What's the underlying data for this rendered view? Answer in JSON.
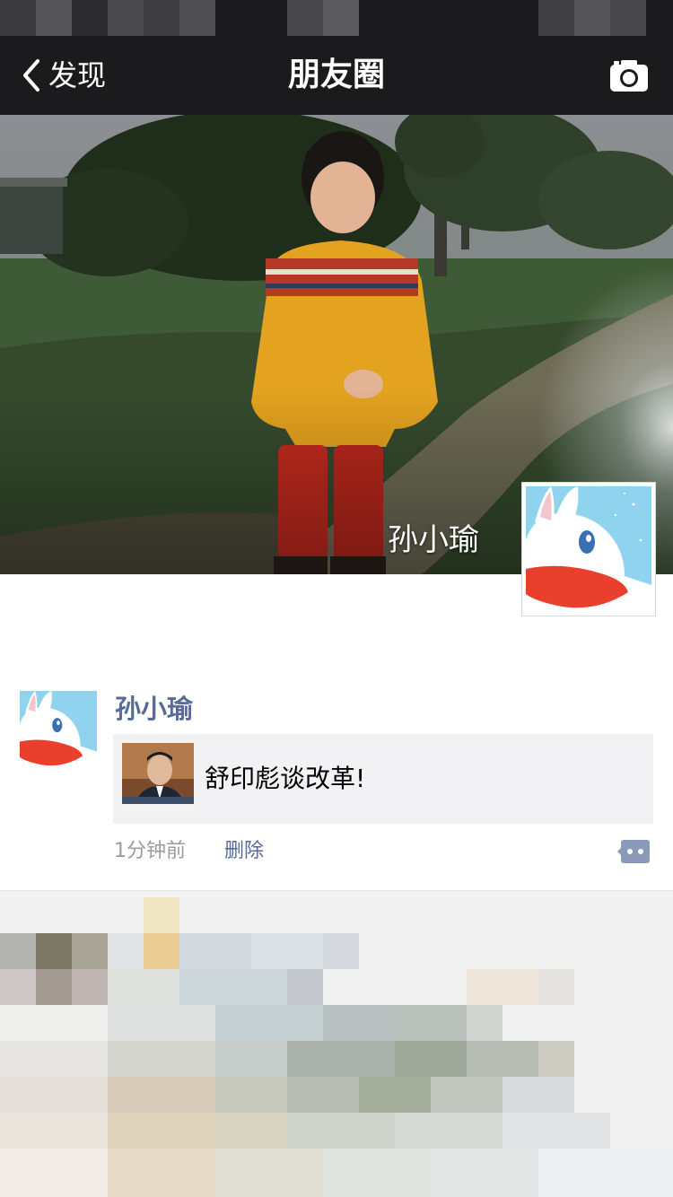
{
  "nav": {
    "back_label": "发现",
    "title": "朋友圈",
    "back_icon": "chevron-left-icon",
    "camera_icon": "camera-icon"
  },
  "profile": {
    "cover_name": "孙小瑜",
    "avatar_icon": "rabbit-avatar"
  },
  "post": {
    "author": "孙小瑜",
    "share_text": "舒印彪谈改革!",
    "time": "1分钟前",
    "delete_label": "删除",
    "comment_icon": "comment-icon"
  },
  "colors": {
    "nav_bg": "#1b1b1d",
    "link": "#576b95",
    "card_bg": "#f2f2f4",
    "meta": "#9b9b9b"
  }
}
